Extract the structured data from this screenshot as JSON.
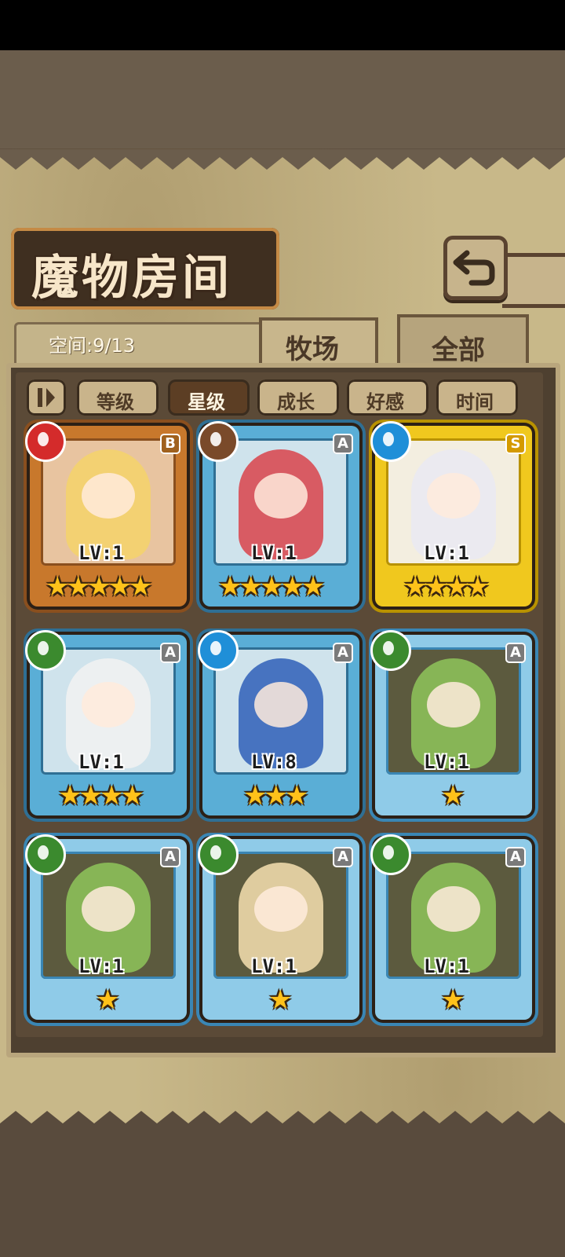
{
  "title": "魔物房间",
  "space_text": "空间:9/13",
  "tabs": {
    "ranch": "牧场",
    "all": "全部"
  },
  "sort": {
    "toggle_icon": "pause-order-icon",
    "options": [
      "等级",
      "星级",
      "成长",
      "好感",
      "时间"
    ],
    "active_index": 1
  },
  "back_icon": "return-arrow-icon",
  "monsters": [
    {
      "level": "LV:1",
      "grade": "B",
      "element": "fire-icon",
      "stars": 5,
      "frame": "bronze"
    },
    {
      "level": "LV:1",
      "grade": "A",
      "element": "earth-icon",
      "stars": 5,
      "frame": "silver"
    },
    {
      "level": "LV:1",
      "grade": "S",
      "element": "water-icon",
      "stars": 4,
      "frame": "gold"
    },
    {
      "level": "LV:1",
      "grade": "A",
      "element": "leaf-icon",
      "stars": 4,
      "frame": "silver"
    },
    {
      "level": "LV:8",
      "grade": "A",
      "element": "water-icon",
      "stars": 3,
      "frame": "silver"
    },
    {
      "level": "LV:1",
      "grade": "A",
      "element": "leaf-icon",
      "stars": 1,
      "frame": "blue"
    },
    {
      "level": "LV:1",
      "grade": "A",
      "element": "leaf-icon",
      "stars": 1,
      "frame": "blue"
    },
    {
      "level": "LV:1",
      "grade": "A",
      "element": "leaf-icon",
      "stars": 1,
      "frame": "blue"
    },
    {
      "level": "LV:1",
      "grade": "A",
      "element": "leaf-icon",
      "stars": 1,
      "frame": "blue"
    }
  ],
  "colors": {
    "fire": "#d42b2b",
    "earth": "#7a4a2a",
    "water": "#1f8fd8",
    "leaf": "#3b8a2e"
  }
}
